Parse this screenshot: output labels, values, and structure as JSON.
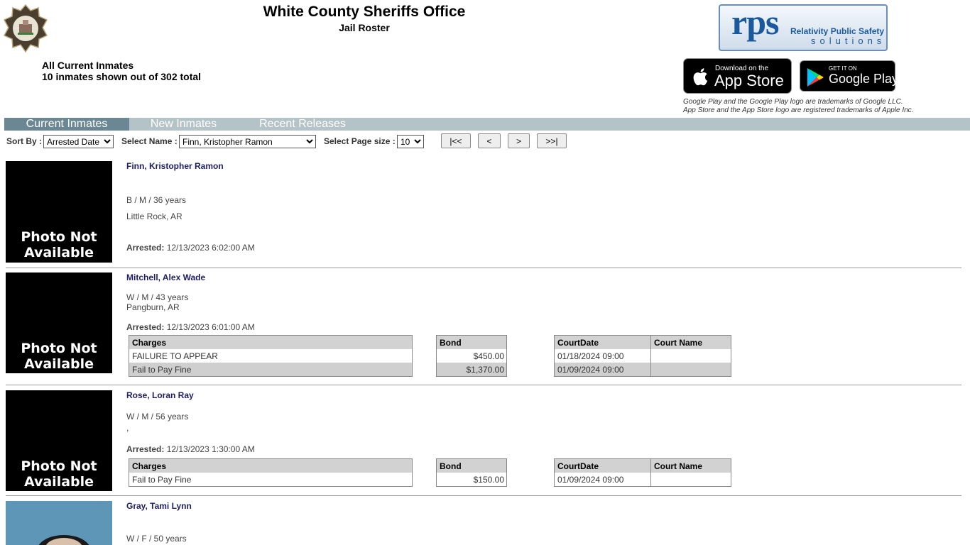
{
  "header": {
    "title": "White County Sheriffs Office",
    "subtitle": "Jail Roster",
    "badge_text": "SHERIFF WHITE COUNTY",
    "summary_line1": "All Current Inmates",
    "summary_line2": "10 inmates shown out of 302 total"
  },
  "rps": {
    "big": "rps",
    "line1": "Relativity Public Safety",
    "line2": "solutions"
  },
  "stores": {
    "apple_small": "Download on the",
    "apple_main": "App Store",
    "google_small": "GET IT ON",
    "google_main": "Google Play",
    "notice1": "Google Play and the Google Play logo are trademarks of Google LLC.",
    "notice2": "App Store and the App Store logo are registered trademarks of Apple Inc."
  },
  "tabs": [
    "Current Inmates",
    "New Inmates",
    "Recent Releases"
  ],
  "controls": {
    "sort_label": "Sort By :",
    "sort_value": "Arrested Date",
    "name_label": "Select Name :",
    "name_value": "Finn, Kristopher Ramon",
    "pagesize_label": "Select Page size :",
    "pagesize_value": "10",
    "first": "|<<",
    "prev": "<",
    "next": ">",
    "last": ">>|"
  },
  "photo_placeholder": [
    "Photo Not",
    "Available"
  ],
  "arrested_label": "Arrested:",
  "columns": {
    "charges": "Charges",
    "bond": "Bond",
    "court_date": "CourtDate",
    "court_name": "Court Name"
  },
  "inmates": [
    {
      "name": "Finn, Kristopher Ramon",
      "demo": "B / M / 36 years",
      "city": "Little Rock, AR",
      "arrested": "12/13/2023 6:02:00 AM",
      "charges": []
    },
    {
      "name": "Mitchell, Alex Wade",
      "demo": "W / M / 43 years",
      "city": "Pangburn, AR",
      "arrested": "12/13/2023 6:01:00 AM",
      "charges": [
        {
          "charge": "FAILURE TO APPEAR",
          "bond": "$450.00",
          "court_date": "01/18/2024 09:00",
          "court_name": ""
        },
        {
          "charge": "Fail to Pay Fine",
          "bond": "$1,370.00",
          "court_date": "01/09/2024 09:00",
          "court_name": ""
        }
      ]
    },
    {
      "name": "Rose, Loran Ray",
      "demo": "W / M / 56 years",
      "city": ",",
      "arrested": "12/13/2023 1:30:00 AM",
      "charges": [
        {
          "charge": "Fail to Pay Fine",
          "bond": "$150.00",
          "court_date": "01/09/2024 09:00",
          "court_name": ""
        }
      ]
    },
    {
      "name": "Gray, Tami Lynn",
      "demo": "W / F / 50 years"
    }
  ]
}
